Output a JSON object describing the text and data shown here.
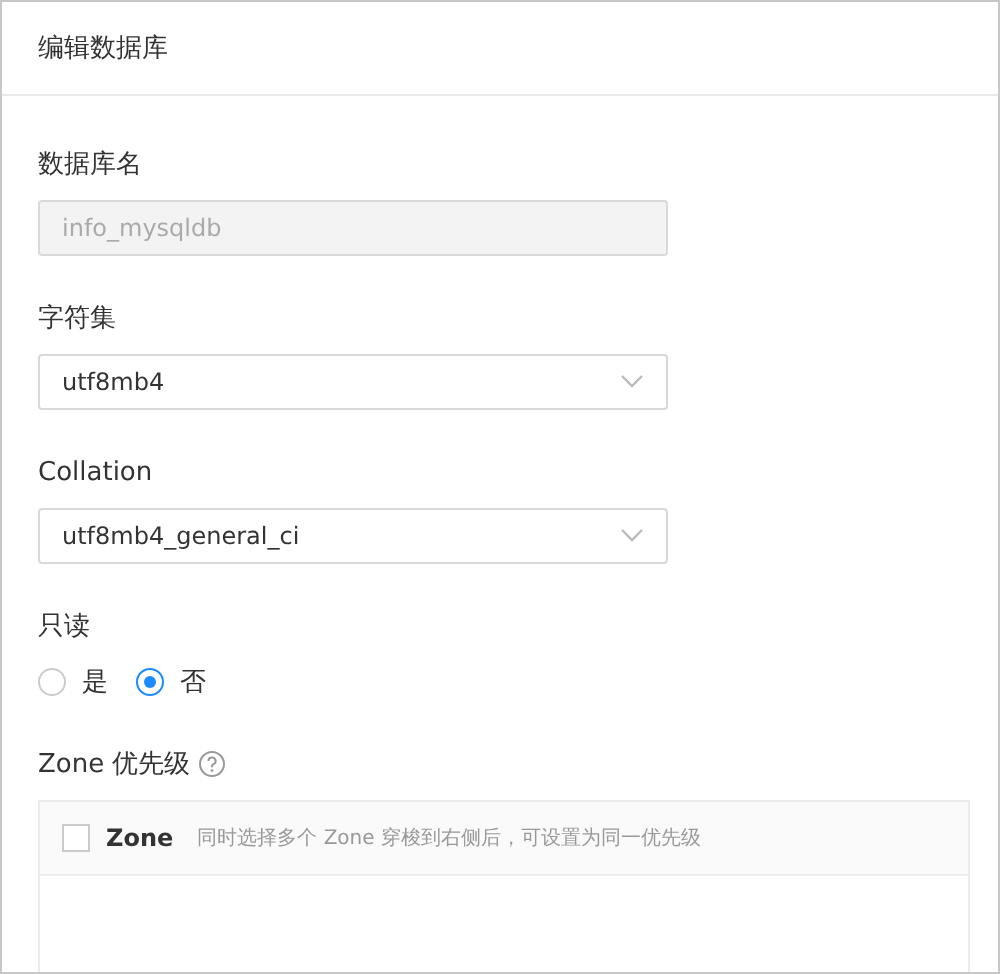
{
  "dialog": {
    "title": "编辑数据库"
  },
  "fields": [
    {
      "kind": "input",
      "label": "数据库名",
      "value": "info_mysqldb",
      "disabled": true
    },
    {
      "kind": "select",
      "label": "字符集",
      "value": "utf8mb4"
    },
    {
      "kind": "select",
      "label": "Collation",
      "value": "utf8mb4_general_ci"
    },
    {
      "kind": "radio",
      "label": "只读",
      "options": [
        {
          "label": "是",
          "selected": false
        },
        {
          "label": "否",
          "selected": true
        }
      ]
    },
    {
      "kind": "transfer",
      "label": "Zone 优先级",
      "help": true,
      "header": {
        "checked": false,
        "title": "Zone",
        "hint": "同时选择多个 Zone 穿梭到右侧后，可设置为同一优先级"
      }
    }
  ]
}
